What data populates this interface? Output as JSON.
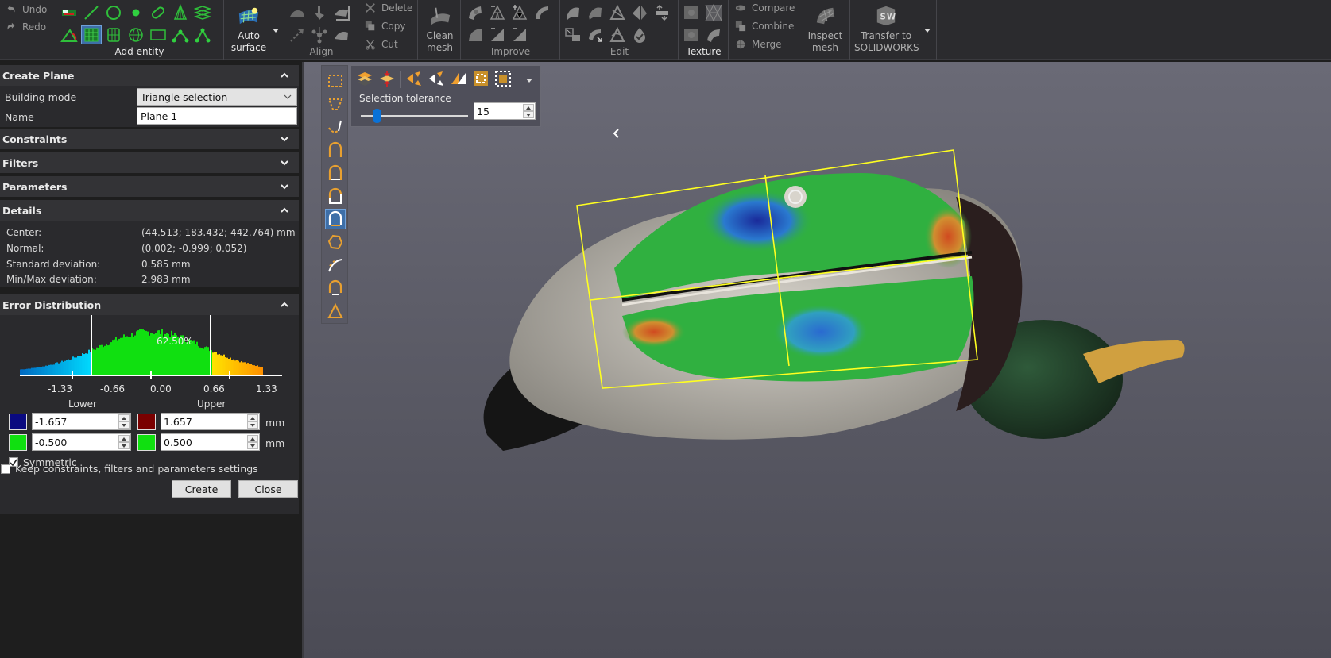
{
  "ribbon": {
    "undo": "Undo",
    "redo": "Redo",
    "groups": {
      "add_entity": "Add entity",
      "auto_surface": [
        "Auto",
        "surface"
      ],
      "align": "Align",
      "clean_mesh": [
        "Clean",
        "mesh"
      ],
      "improve": "Improve",
      "edit": "Edit",
      "texture": "Texture",
      "inspect_mesh": [
        "Inspect",
        "mesh"
      ],
      "transfer": [
        "Transfer to",
        "SOLIDWORKS"
      ]
    },
    "clipboard": {
      "delete": "Delete",
      "copy": "Copy",
      "cut": "Cut"
    },
    "combine_group": {
      "compare": "Compare",
      "combine": "Combine",
      "merge": "Merge"
    },
    "add_entity_icons": [
      "point-cloud-icon",
      "line-icon",
      "circle-icon",
      "point-icon",
      "slot-icon",
      "cone-icon",
      "layers-icon",
      "angle-icon",
      "plane-icon",
      "cylinder-icon",
      "sphere-icon",
      "rectangle-icon",
      "spline-icon",
      "polyline-icon"
    ],
    "selected_entity": "plane-icon"
  },
  "panel": {
    "create_plane": {
      "title": "Create Plane",
      "building_mode_label": "Building mode",
      "building_mode_value": "Triangle selection",
      "name_label": "Name",
      "name_value": "Plane 1"
    },
    "sections": {
      "constraints": "Constraints",
      "filters": "Filters",
      "parameters": "Parameters",
      "details": "Details",
      "error_distribution": "Error Distribution"
    },
    "details": [
      {
        "label": "Center:",
        "value": "(44.513; 183.432; 442.764) mm"
      },
      {
        "label": "Normal:",
        "value": "(0.002; -0.999; 0.052)"
      },
      {
        "label": "Standard deviation:",
        "value": "0.585 mm"
      },
      {
        "label": "Min/Max deviation:",
        "value": "2.983 mm"
      }
    ],
    "error_distribution": {
      "percent_label": "62.50%",
      "ticks": [
        "-1.33",
        "-0.66",
        "0.00",
        "0.66",
        "1.33"
      ],
      "lower_label": "Lower",
      "upper_label": "Upper",
      "lower_outer": "-1.657",
      "upper_outer": "1.657",
      "lower_inner": "-0.500",
      "upper_inner": "0.500",
      "unit": "mm",
      "colors": {
        "lower_outer": "#0a0a80",
        "upper_outer": "#7a0000",
        "lower_inner": "#10e010",
        "upper_inner": "#10e010"
      },
      "symmetric_label": "Symmetric",
      "symmetric_checked": true
    },
    "keep_settings_label": "Keep constraints, filters and parameters settings",
    "keep_settings_checked": false,
    "create_button": "Create",
    "close_button": "Close"
  },
  "viewport": {
    "selection_tolerance_label": "Selection tolerance",
    "selection_tolerance_value": "15",
    "selection_tolerance_fraction": 0.15,
    "side_tools": [
      "rect-select-icon",
      "lasso-select-icon",
      "brush-select-icon",
      "region-select-1-icon",
      "region-select-2-icon",
      "region-select-3-icon",
      "region-select-4-icon",
      "polygon-select-icon",
      "path-select-icon",
      "region-select-5-icon",
      "triangle-select-icon"
    ],
    "selected_side_tool": "region-select-4-icon",
    "colors": {
      "accent": "#3e6fa8",
      "selection_outline": "#ffff20"
    }
  }
}
